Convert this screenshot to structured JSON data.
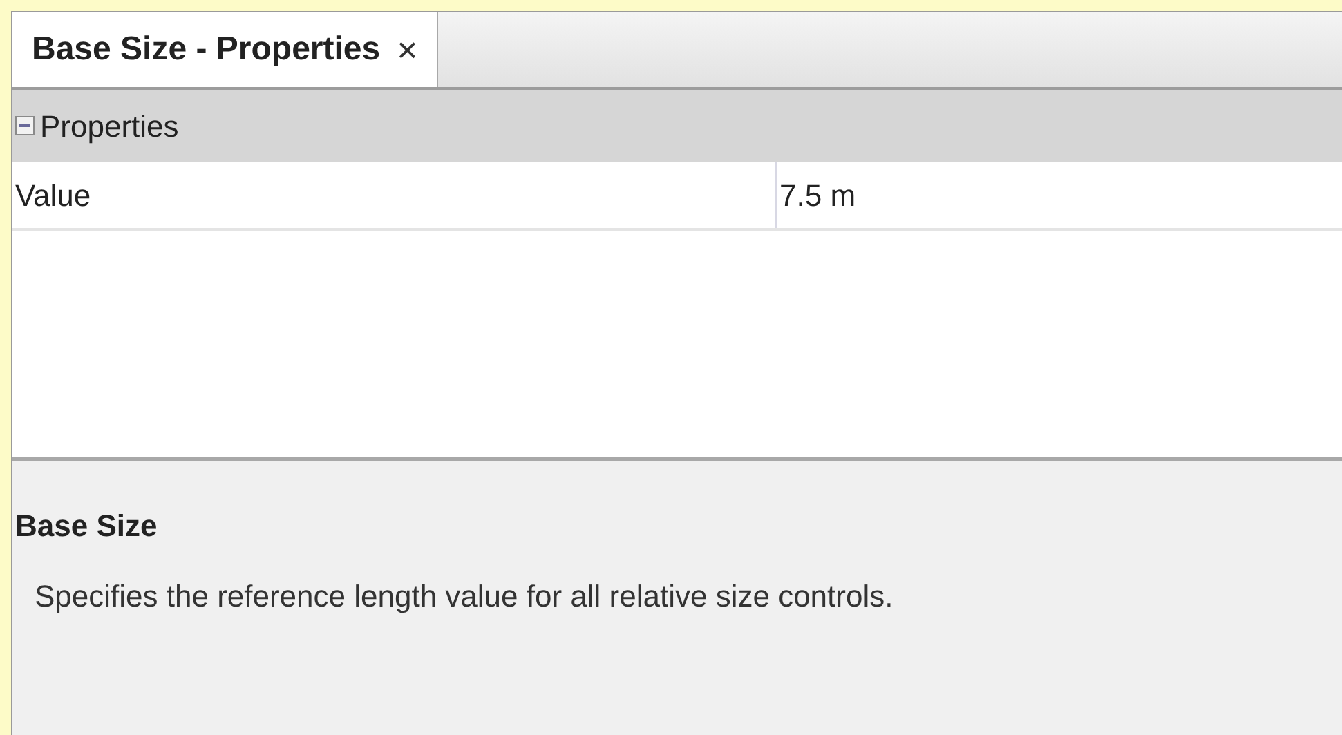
{
  "tab": {
    "label": "Base Size - Properties",
    "close": "×",
    "selected": true
  },
  "group": {
    "label": "Properties",
    "expanded": true
  },
  "rows": [
    {
      "name": "Value",
      "value": "7.5 m"
    }
  ],
  "description": {
    "title": "Base Size",
    "text": "Specifies the reference length value for all relative size controls."
  }
}
